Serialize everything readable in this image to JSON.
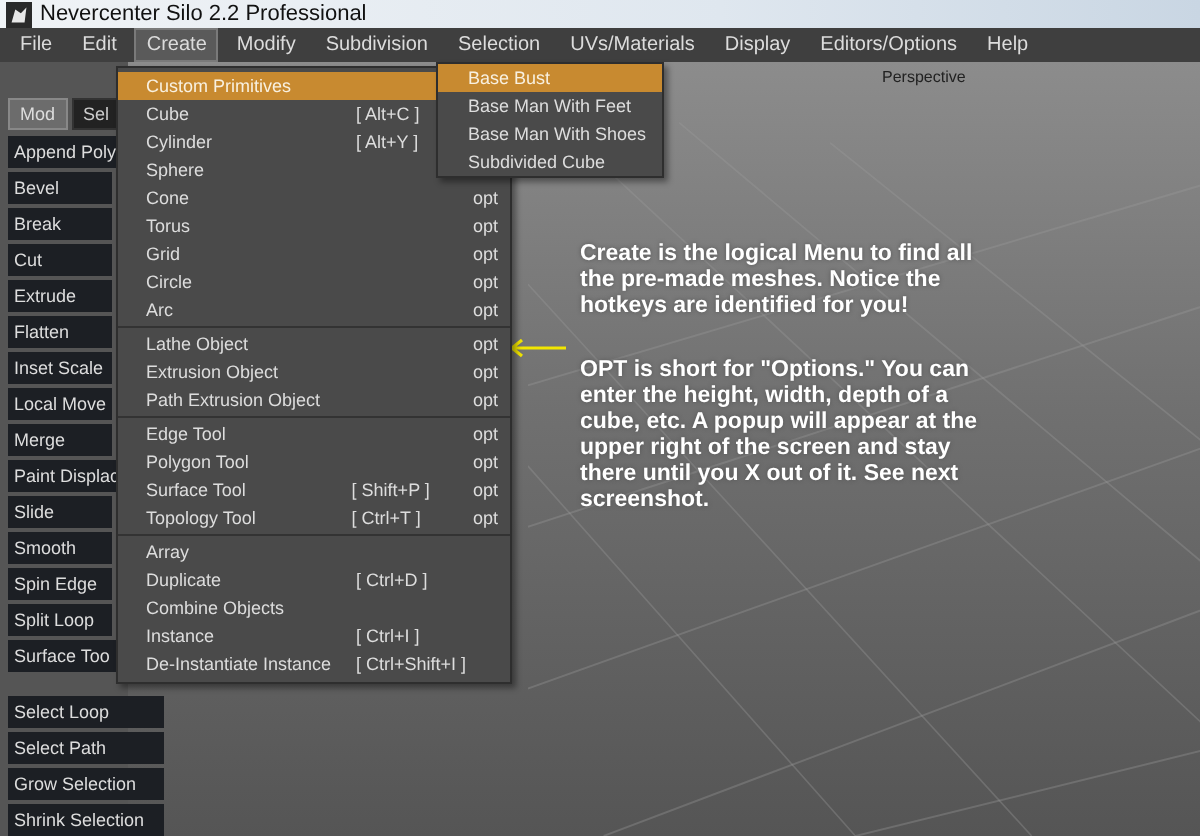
{
  "window": {
    "title": "Nevercenter Silo 2.2 Professional"
  },
  "menubar": [
    {
      "label": "File",
      "selected": false
    },
    {
      "label": "Edit",
      "selected": false
    },
    {
      "label": "Create",
      "selected": true
    },
    {
      "label": "Modify",
      "selected": false
    },
    {
      "label": "Subdivision",
      "selected": false
    },
    {
      "label": "Selection",
      "selected": false
    },
    {
      "label": "UVs/Materials",
      "selected": false
    },
    {
      "label": "Display",
      "selected": false
    },
    {
      "label": "Editors/Options",
      "selected": false
    },
    {
      "label": "Help",
      "selected": false
    }
  ],
  "left_panel": {
    "tabs": [
      {
        "label": "Mod",
        "selected": true
      },
      {
        "label": "Sel",
        "selected": false
      }
    ],
    "tools": [
      "Append Poly",
      "Bevel",
      "Break",
      "Cut",
      "Extrude",
      "Flatten",
      "Inset Scale",
      "Local Move",
      "Merge",
      "Paint Displac",
      "Slide",
      "Smooth",
      "Spin Edge",
      "Split Loop",
      "Surface Too"
    ],
    "selection_tools": [
      "Select Loop",
      "Select Path",
      "Grow Selection",
      "Shrink Selection"
    ]
  },
  "create_menu": {
    "groups": [
      [
        {
          "label": "Custom Primitives",
          "submenu": true,
          "selected": true
        },
        {
          "label": "Cube",
          "shortcut": "[ Alt+C ]",
          "selected": false
        },
        {
          "label": "Cylinder",
          "shortcut": "[ Alt+Y ]",
          "selected": false
        },
        {
          "label": "Sphere",
          "selected": false
        },
        {
          "label": "Cone",
          "options": "opt",
          "selected": false
        },
        {
          "label": "Torus",
          "options": "opt",
          "selected": false
        },
        {
          "label": "Grid",
          "options": "opt",
          "selected": false
        },
        {
          "label": "Circle",
          "options": "opt",
          "selected": false
        },
        {
          "label": "Arc",
          "options": "opt",
          "selected": false
        }
      ],
      [
        {
          "label": "Lathe Object",
          "options": "opt",
          "selected": false
        },
        {
          "label": "Extrusion Object",
          "options": "opt",
          "selected": false
        },
        {
          "label": "Path Extrusion Object",
          "options": "opt",
          "selected": false
        }
      ],
      [
        {
          "label": "Edge Tool",
          "options": "opt",
          "selected": false
        },
        {
          "label": "Polygon Tool",
          "options": "opt",
          "selected": false
        },
        {
          "label": "Surface Tool",
          "shortcut": "[ Shift+P ]",
          "options": "opt",
          "selected": false
        },
        {
          "label": "Topology Tool",
          "shortcut": "[ Ctrl+T ]",
          "options": "opt",
          "selected": false
        }
      ],
      [
        {
          "label": "Array",
          "selected": false
        },
        {
          "label": "Duplicate",
          "shortcut": "[ Ctrl+D ]",
          "selected": false
        },
        {
          "label": "Combine Objects",
          "selected": false
        },
        {
          "label": "Instance",
          "shortcut": "[ Ctrl+I ]",
          "selected": false
        },
        {
          "label": "De-Instantiate Instance",
          "shortcut": "[ Ctrl+Shift+I ]",
          "selected": false
        }
      ]
    ]
  },
  "submenu": [
    {
      "label": "Base Bust",
      "selected": true
    },
    {
      "label": "Base Man With Feet",
      "selected": false
    },
    {
      "label": "Base Man With Shoes",
      "selected": false
    },
    {
      "label": "Subdivided Cube",
      "selected": false
    }
  ],
  "viewport": {
    "label": "Perspective"
  },
  "annotations": [
    "Create is the logical Menu to find all the pre-made meshes. Notice the hotkeys are identified for you!",
    "OPT is short for \"Options.\" You can enter the height, width, depth of a cube, etc. A popup will appear at the upper right of the screen and stay there until you X out of it. See next screenshot."
  ]
}
